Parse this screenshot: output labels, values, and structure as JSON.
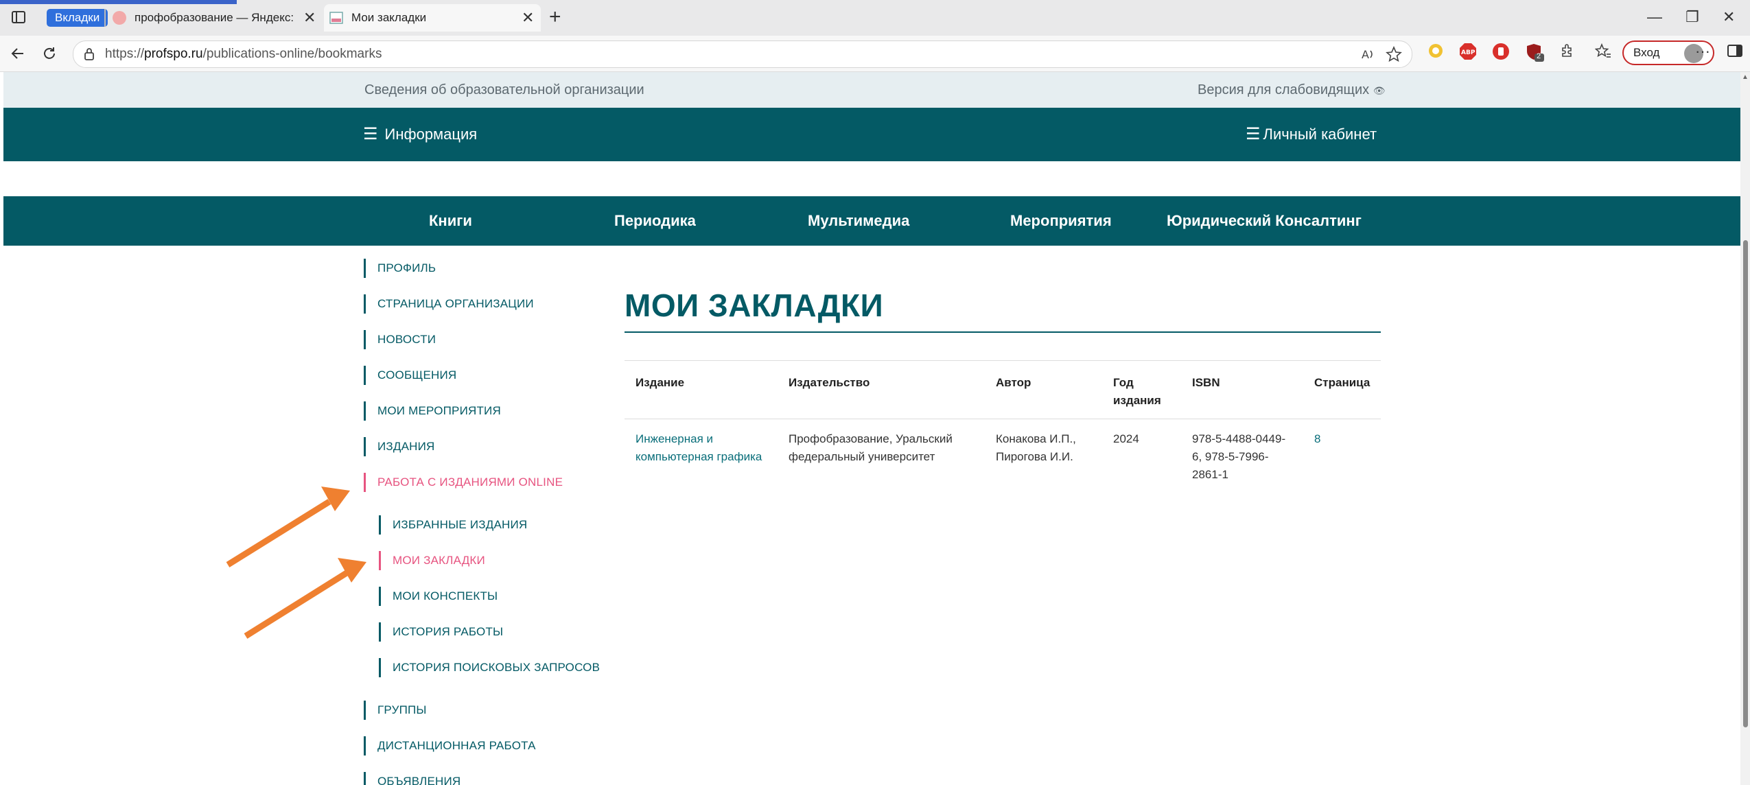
{
  "browser": {
    "tab_group_label": "Вкладки",
    "tabs": [
      {
        "title": "профобразование — Яндекс: на",
        "close": "✕"
      },
      {
        "title": "Мои закладки",
        "close": "✕"
      }
    ],
    "new_tab": "+",
    "window_controls": {
      "minimize": "—",
      "restore": "❐",
      "close": "✕"
    },
    "url_scheme": "https://",
    "url_host": "profspo.ru",
    "url_path": "/publications-online/bookmarks",
    "login_label": "Вход",
    "extensions": [
      "abp-icon",
      "shield-icon",
      "ublock-icon"
    ],
    "ext_badge": "2",
    "more": "···"
  },
  "site": {
    "topbar": {
      "org_info": "Сведения об образовательной организации",
      "accessible_version": "Версия для слабовидящих"
    },
    "nav1": {
      "info": "Информация",
      "cabinet": "Личный кабинет"
    },
    "nav2": [
      "Книги",
      "Периодика",
      "Мультимедиа",
      "Мероприятия",
      "Юридический Консалтинг"
    ],
    "sidebar": {
      "items": [
        "Профиль",
        "Страница организации",
        "Новости",
        "Сообщения",
        "Мои мероприятия",
        "Издания",
        "Работа с изданиями online"
      ],
      "sub_items": [
        "Избранные издания",
        "Мои закладки",
        "Мои конспекты",
        "История работы",
        "История поисковых запросов"
      ],
      "items_after": [
        "Группы",
        "Дистанционная работа",
        "Объявления"
      ]
    },
    "main": {
      "title": "МОИ ЗАКЛАДКИ",
      "table": {
        "headers": [
          "Издание",
          "Издательство",
          "Автор",
          "Год издания",
          "ISBN",
          "Страница"
        ],
        "rows": [
          {
            "edition": "Инженерная и компьютерная графика",
            "publisher": "Профобразование, Уральский федеральный университет",
            "author": "Конакова И.П., Пирогова И.И.",
            "year": "2024",
            "isbn": "978-5-4488-0449-6, 978-5-7996-2861-1",
            "page": "8"
          }
        ]
      }
    }
  },
  "colors": {
    "brand": "#045a65",
    "active": "#e75480",
    "arrow": "#ef8030"
  }
}
